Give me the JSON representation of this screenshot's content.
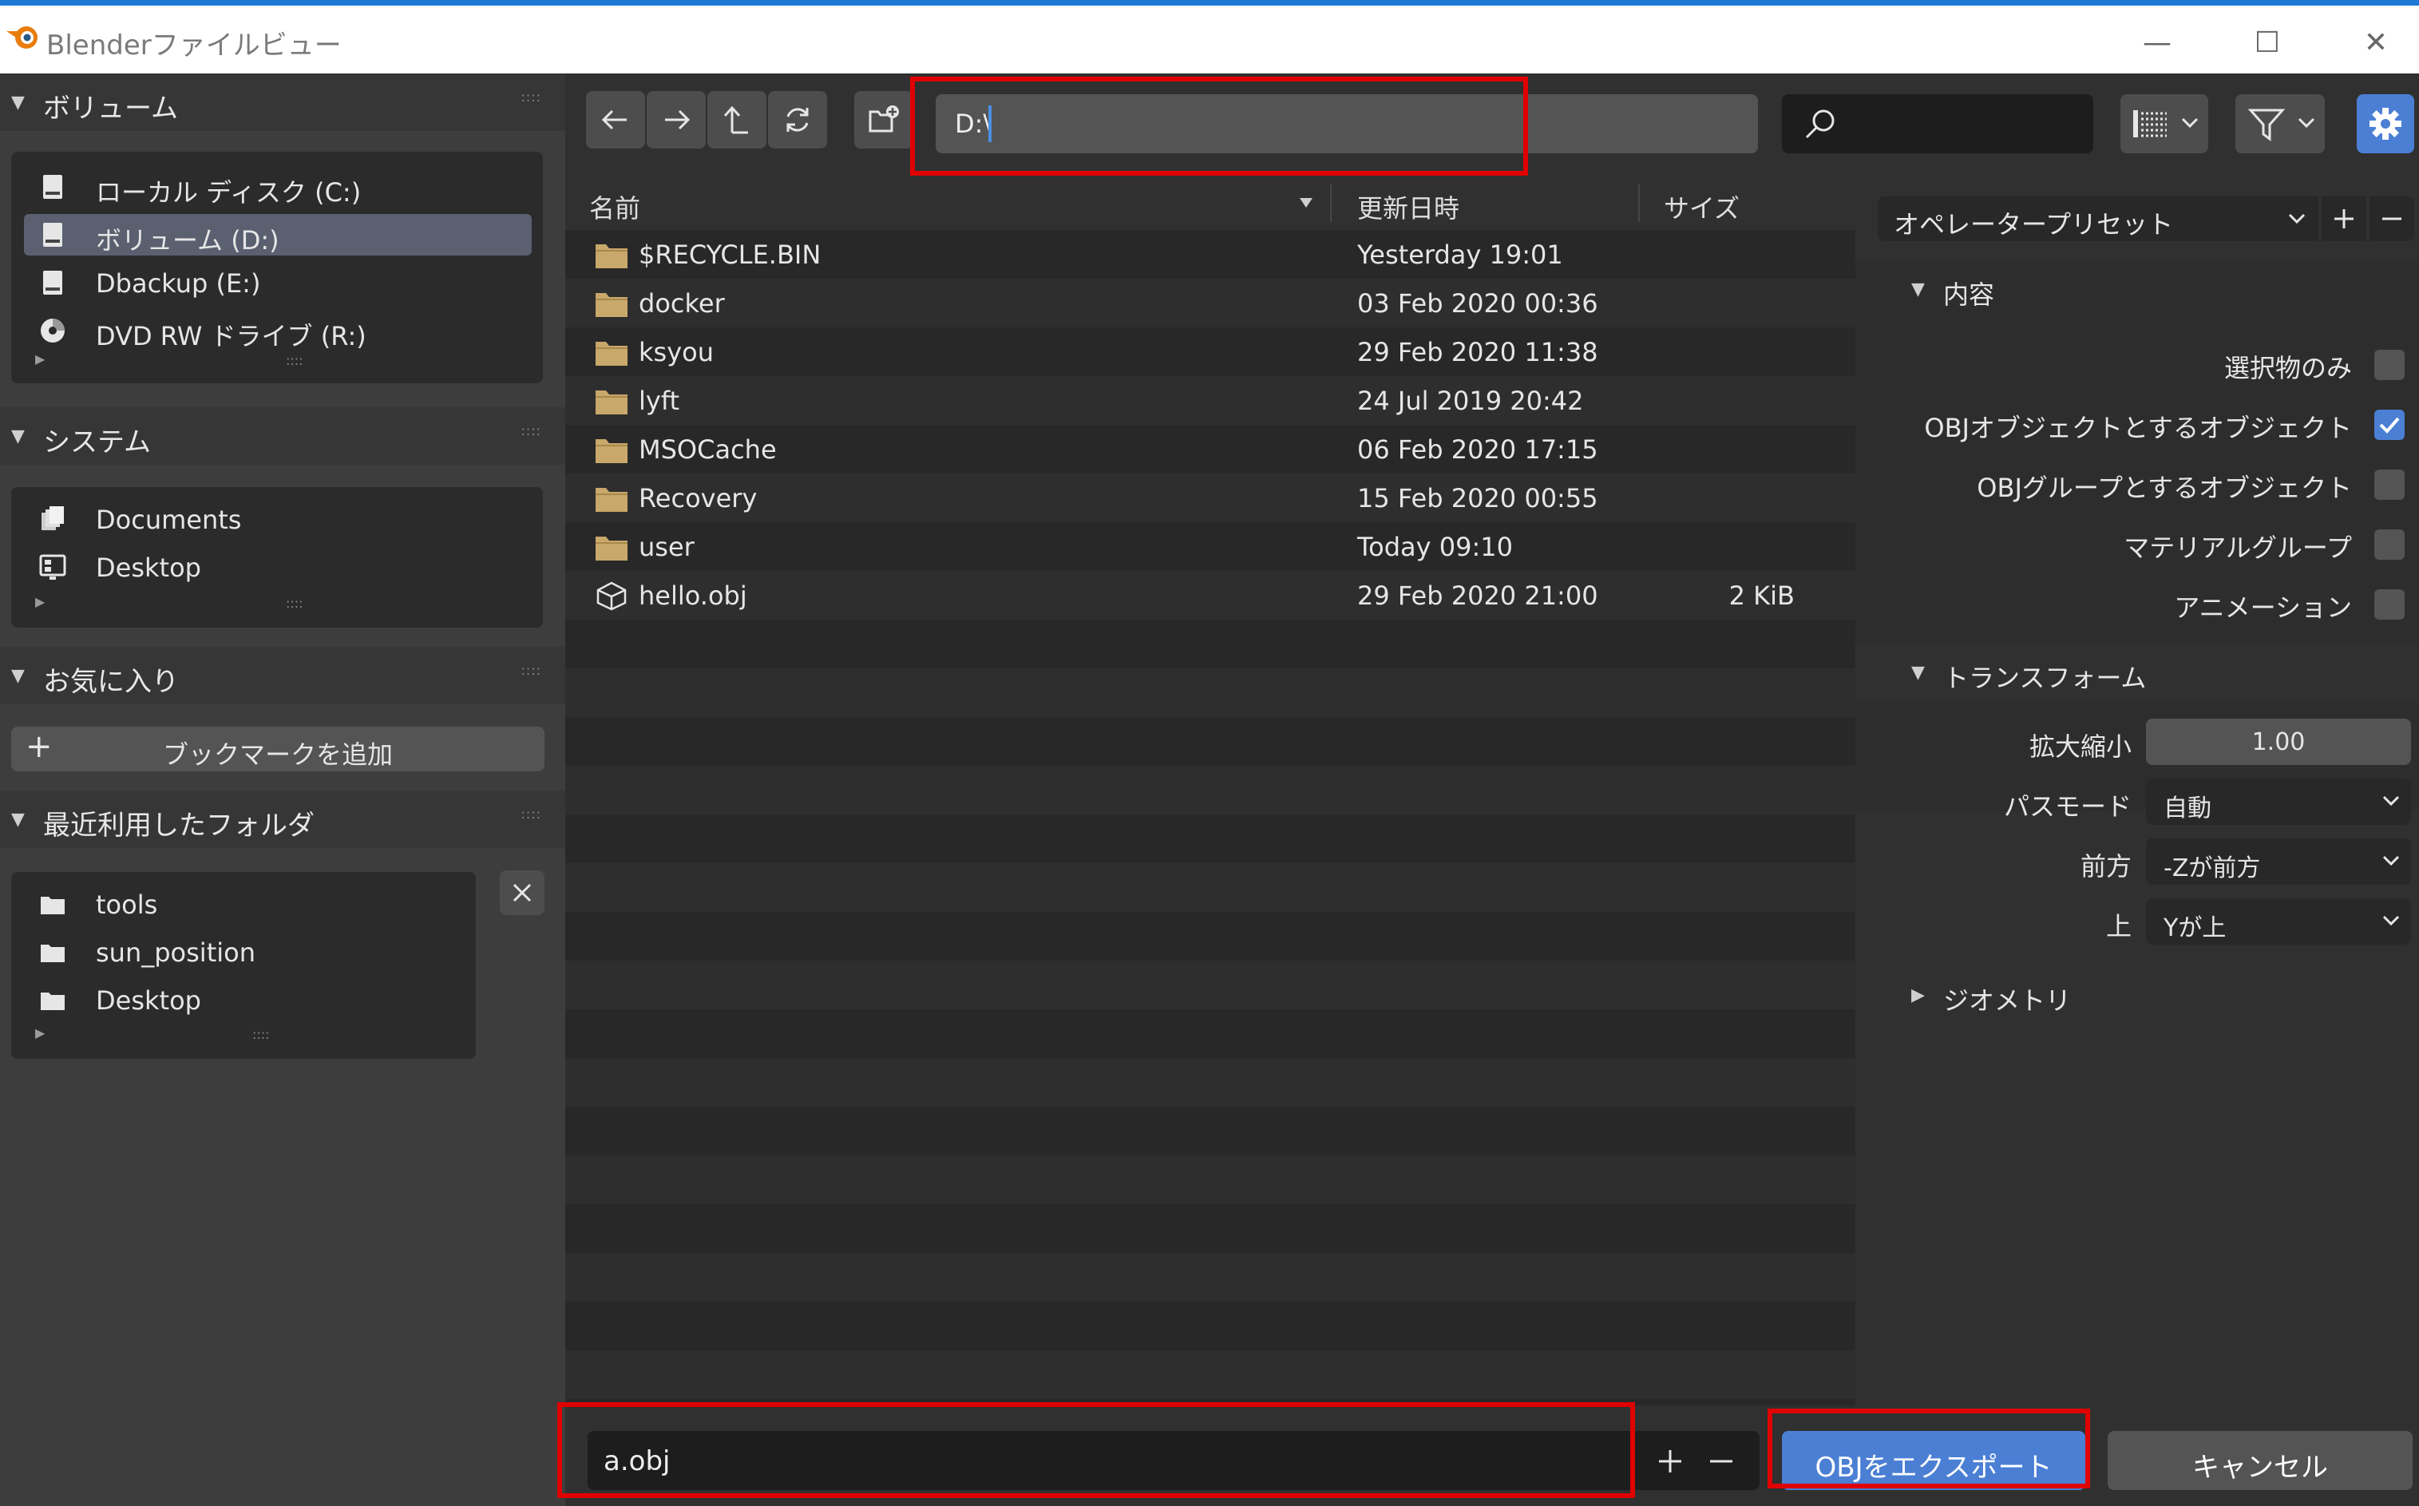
{
  "window": {
    "title": "Blenderファイルビュー",
    "controls": {
      "minimize": "—",
      "maximize": "☐",
      "close": "✕"
    }
  },
  "sidebar": {
    "sections": [
      {
        "title": "ボリューム",
        "items": [
          {
            "label": "ローカル ディスク (C:)",
            "icon": "disk-icon",
            "selected": false
          },
          {
            "label": "ボリューム (D:)",
            "icon": "disk-icon",
            "selected": true
          },
          {
            "label": "Dbackup (E:)",
            "icon": "disk-icon",
            "selected": false
          },
          {
            "label": "DVD RW ドライブ (R:)",
            "icon": "disc-icon",
            "selected": false
          }
        ]
      },
      {
        "title": "システム",
        "items": [
          {
            "label": "Documents",
            "icon": "documents-icon"
          },
          {
            "label": "Desktop",
            "icon": "desktop-icon"
          }
        ]
      },
      {
        "title": "お気に入り",
        "add_bookmark": "ブックマークを追加"
      },
      {
        "title": "最近利用したフォルダ",
        "items": [
          {
            "label": "tools",
            "icon": "folder-icon"
          },
          {
            "label": "sun_position",
            "icon": "folder-icon"
          },
          {
            "label": "Desktop",
            "icon": "folder-icon"
          }
        ]
      }
    ]
  },
  "toolbar": {
    "path": "D:\\",
    "search_placeholder": ""
  },
  "filelist": {
    "columns": {
      "name": "名前",
      "date": "更新日時",
      "size": "サイズ"
    },
    "rows": [
      {
        "name": "$RECYCLE.BIN",
        "date": "Yesterday 19:01",
        "size": "",
        "type": "folder"
      },
      {
        "name": "docker",
        "date": "03 Feb 2020 00:36",
        "size": "",
        "type": "folder"
      },
      {
        "name": "ksyou",
        "date": "29 Feb 2020 11:38",
        "size": "",
        "type": "folder"
      },
      {
        "name": "lyft",
        "date": "24 Jul 2019 20:42",
        "size": "",
        "type": "folder"
      },
      {
        "name": "MSOCache",
        "date": "06 Feb 2020 17:15",
        "size": "",
        "type": "folder"
      },
      {
        "name": "Recovery",
        "date": "15 Feb 2020 00:55",
        "size": "",
        "type": "folder"
      },
      {
        "name": "user",
        "date": "Today 09:10",
        "size": "",
        "type": "folder"
      },
      {
        "name": "hello.obj",
        "date": "29 Feb 2020 21:00",
        "size": "2 KiB",
        "type": "object"
      }
    ]
  },
  "bottom": {
    "filename": "a.obj",
    "export_label": "OBJをエクスポート",
    "cancel_label": "キャンセル"
  },
  "panel": {
    "preset": "オペレータープリセット",
    "contents_title": "内容",
    "checkboxes": [
      {
        "label": "選択物のみ",
        "checked": false
      },
      {
        "label": "OBJオブジェクトとするオブジェクト",
        "checked": true
      },
      {
        "label": "OBJグループとするオブジェクト",
        "checked": false
      },
      {
        "label": "マテリアルグループ",
        "checked": false
      },
      {
        "label": "アニメーション",
        "checked": false
      }
    ],
    "transform_title": "トランスフォーム",
    "scale_label": "拡大縮小",
    "scale_value": "1.00",
    "path_mode_label": "パスモード",
    "path_mode_value": "自動",
    "forward_label": "前方",
    "forward_value": "-Zが前方",
    "up_label": "上",
    "up_value": "Yが上",
    "geometry_title": "ジオメトリ"
  },
  "colors": {
    "accent": "#4a7fd4",
    "highlight_box": "#e00000",
    "folder": "#c9a86b"
  }
}
